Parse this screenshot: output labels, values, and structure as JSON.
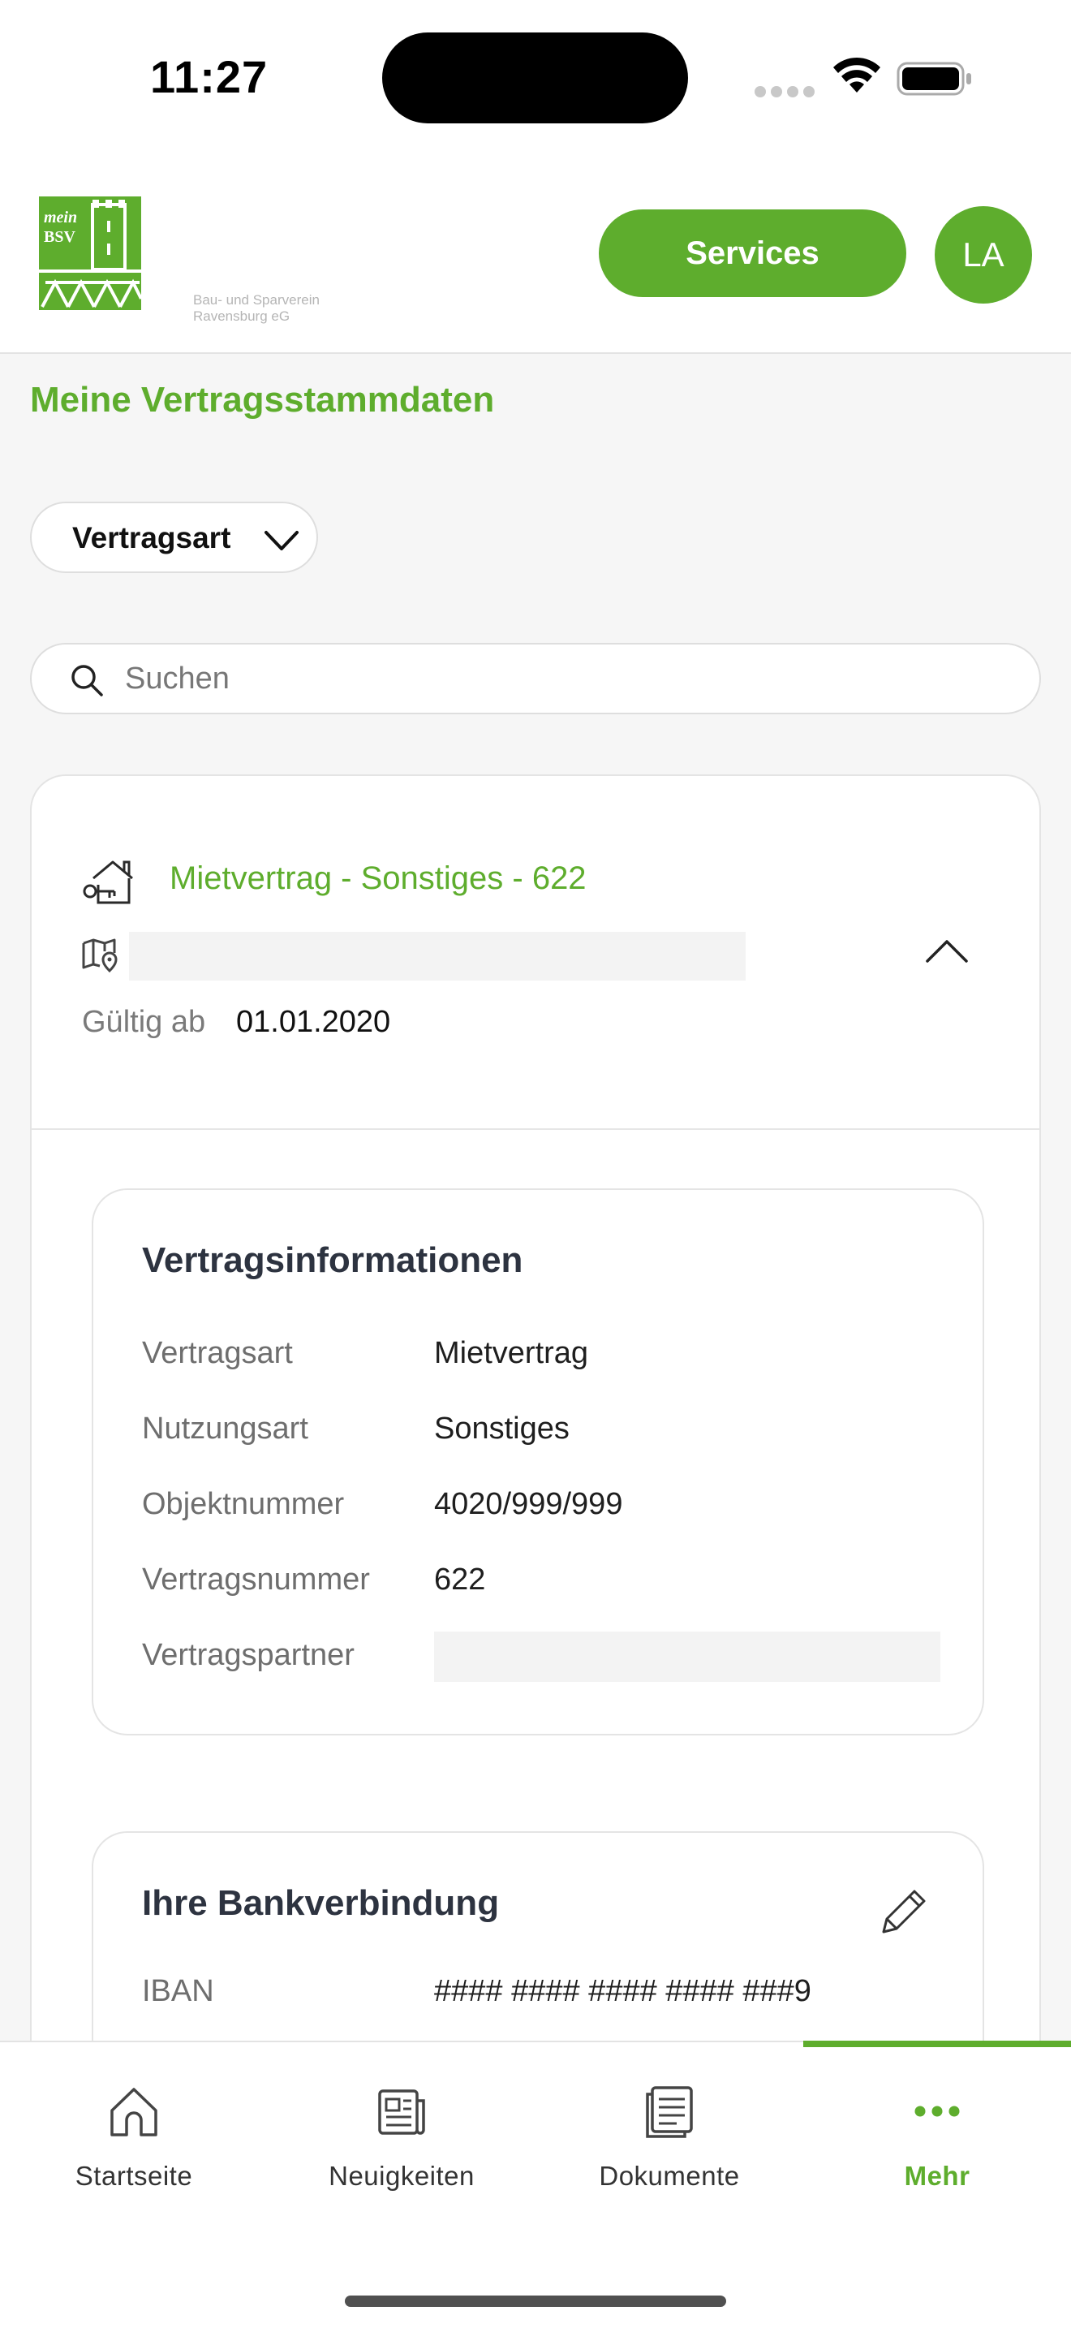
{
  "status_bar": {
    "time": "11:27"
  },
  "header": {
    "logo_word_mein": "mein",
    "logo_word_bsv": "BSV",
    "logo_subtitle_line1": "Bau- und Sparverein",
    "logo_subtitle_line2": "Ravensburg eG",
    "services_label": "Services",
    "avatar_initials": "LA"
  },
  "page": {
    "title": "Meine Vertragsstammdaten"
  },
  "filter": {
    "label": "Vertragsart"
  },
  "search": {
    "placeholder": "Suchen",
    "value": ""
  },
  "contract": {
    "title": "Mietvertrag - Sonstiges - 622",
    "valid_from_label": "Gültig ab",
    "valid_from_value": "01.01.2020"
  },
  "contract_info": {
    "title": "Vertragsinformationen",
    "rows": [
      {
        "label": "Vertragsart",
        "value": "Mietvertrag"
      },
      {
        "label": "Nutzungsart",
        "value": "Sonstiges"
      },
      {
        "label": "Objektnummer",
        "value": "4020/999/999"
      },
      {
        "label": "Vertragsnummer",
        "value": "622"
      },
      {
        "label": "Vertragspartner",
        "value": ""
      }
    ]
  },
  "bank": {
    "title": "Ihre Bankverbindung",
    "iban_label": "IBAN",
    "iban_value": "#### #### #### #### ###9"
  },
  "tabs": [
    {
      "label": "Startseite",
      "icon": "home-icon",
      "active": false
    },
    {
      "label": "Neuigkeiten",
      "icon": "news-icon",
      "active": false
    },
    {
      "label": "Dokumente",
      "icon": "documents-icon",
      "active": false
    },
    {
      "label": "Mehr",
      "icon": "more-icon",
      "active": true
    }
  ],
  "colors": {
    "brand_green": "#5ead2d",
    "background": "#f6f6f6",
    "card": "#ffffff"
  }
}
